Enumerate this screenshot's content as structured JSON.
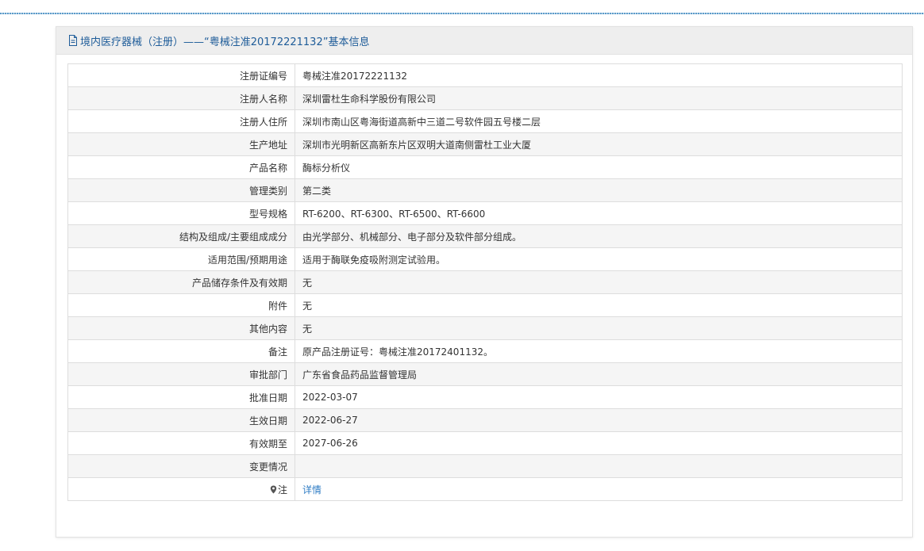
{
  "header": {
    "title": "境内医疗器械（注册）——“粤械注准20172221132”基本信息",
    "icon": "document-icon"
  },
  "rows": [
    {
      "key": "注册证编号",
      "value": "粤械注准20172221132"
    },
    {
      "key": "注册人名称",
      "value": "深圳雷杜生命科学股份有限公司"
    },
    {
      "key": "注册人住所",
      "value": "深圳市南山区粤海街道高新中三道二号软件园五号楼二层"
    },
    {
      "key": "生产地址",
      "value": "深圳市光明新区高新东片区双明大道南侧雷杜工业大厦"
    },
    {
      "key": "产品名称",
      "value": "酶标分析仪"
    },
    {
      "key": "管理类别",
      "value": "第二类"
    },
    {
      "key": "型号规格",
      "value": "RT-6200、RT-6300、RT-6500、RT-6600"
    },
    {
      "key": "结构及组成/主要组成成分",
      "value": "由光学部分、机械部分、电子部分及软件部分组成。"
    },
    {
      "key": "适用范围/预期用途",
      "value": "适用于酶联免疫吸附测定试验用。"
    },
    {
      "key": "产品储存条件及有效期",
      "value": "无"
    },
    {
      "key": "附件",
      "value": "无"
    },
    {
      "key": "其他内容",
      "value": "无"
    },
    {
      "key": "备注",
      "value": "原产品注册证号：粤械注准20172401132。"
    },
    {
      "key": "审批部门",
      "value": "广东省食品药品监督管理局"
    },
    {
      "key": "批准日期",
      "value": "2022-03-07"
    },
    {
      "key": "生效日期",
      "value": "2022-06-27"
    },
    {
      "key": "有效期至",
      "value": "2027-06-26"
    },
    {
      "key": "变更情况",
      "value": ""
    }
  ],
  "note_row": {
    "key": "注",
    "icon": "map-pin-icon",
    "link_label": "详情"
  },
  "colors": {
    "header_text": "#1e5c99",
    "link": "#2e7cc4",
    "stripe": "#f5f5f5"
  }
}
